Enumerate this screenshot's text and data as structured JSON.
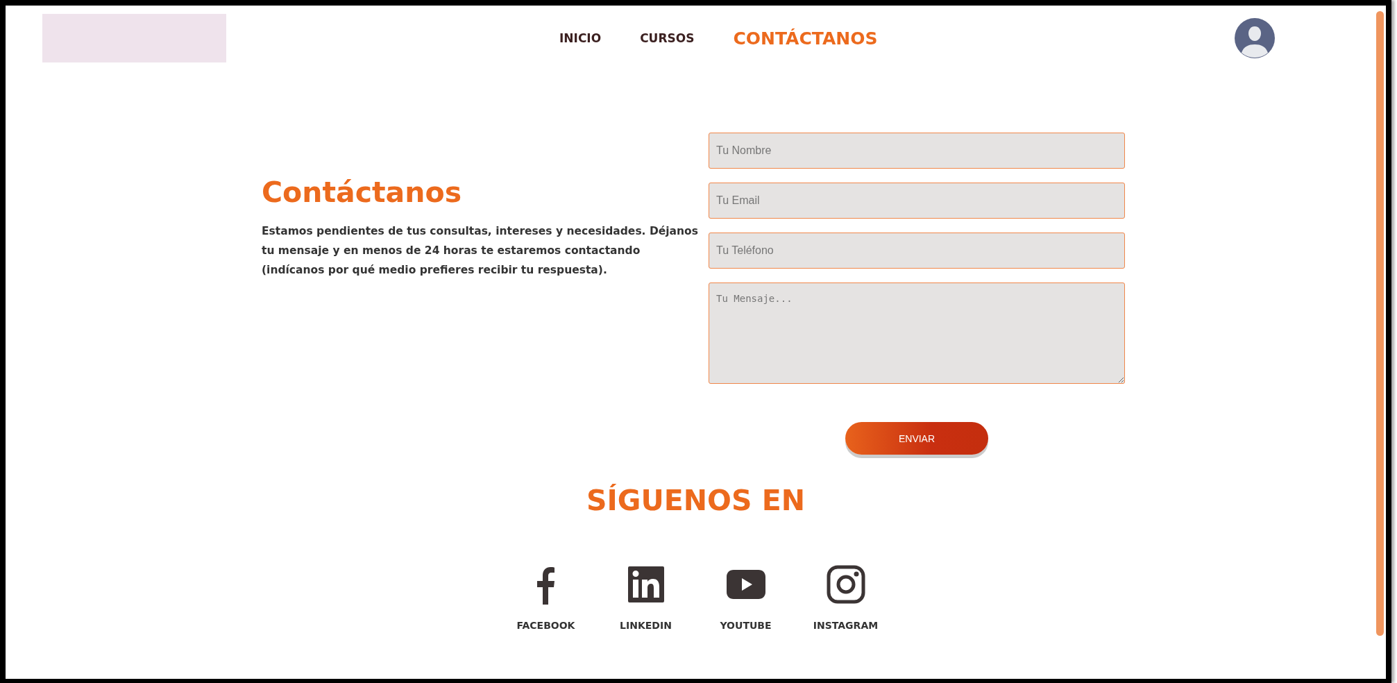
{
  "nav": [
    {
      "label": "INICIO",
      "selected": false
    },
    {
      "label": "CURSOS",
      "selected": false
    },
    {
      "label": "CONTÁCTANOS",
      "selected": true
    }
  ],
  "contact": {
    "title": "Contáctanos",
    "text": "Estamos pendientes de tus consultas, intereses y necesidades. Déjanos tu mensaje y en menos de 24 horas te estaremos contactando (indícanos por qué medio prefieres recibir tu respuesta)."
  },
  "form": {
    "fields": [
      {
        "kind": "input",
        "placeholder": "Tu Nombre"
      },
      {
        "kind": "input",
        "placeholder": "Tu Email"
      },
      {
        "kind": "input",
        "placeholder": "Tu Teléfono"
      },
      {
        "kind": "textarea",
        "placeholder": "Tu Mensaje..."
      }
    ],
    "submit": "ENVIAR"
  },
  "social": {
    "title": "SÍGUENOS EN",
    "links": [
      {
        "kind": "facebook",
        "label": "FACEBOOK"
      },
      {
        "kind": "linkedin",
        "label": "LINKEDIN"
      },
      {
        "kind": "youtube",
        "label": "YOUTUBE"
      },
      {
        "kind": "instagram",
        "label": "INSTAGRAM"
      }
    ]
  }
}
